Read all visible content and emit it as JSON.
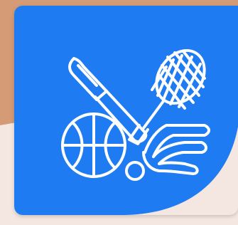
{
  "colors": {
    "background_top": "#D49B76",
    "background_bottom": "#F4E7E1",
    "card_fill": "#1E7BF2",
    "icon_stroke": "#FFFFFF"
  },
  "icon": {
    "name": "sports-equipment-icon",
    "parts": [
      "cricket-bat-icon",
      "badminton-racket-icon",
      "basketball-icon",
      "shuttlecock-icon",
      "ball-icon"
    ]
  }
}
